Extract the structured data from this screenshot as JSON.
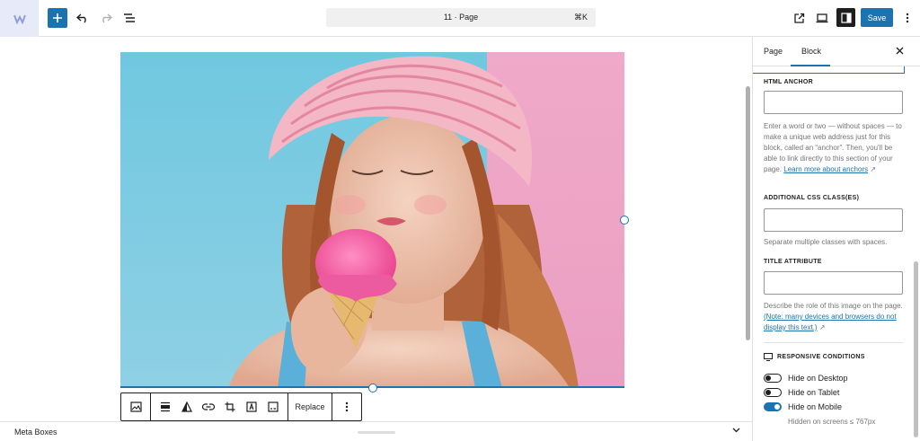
{
  "topbar": {
    "document_title": "11 · Page",
    "shortcut": "⌘K",
    "save_label": "Save",
    "icons": [
      "site-logo-icon",
      "plus-icon",
      "undo-icon",
      "redo-icon",
      "list-view-icon",
      "external-link-icon",
      "desktop-preview-icon",
      "sidebar-icon",
      "more-vertical-icon"
    ]
  },
  "canvas": {
    "image_alt": "Woman in pink knit hat eating pink ice cream cone",
    "toolbar": {
      "replace_label": "Replace",
      "icons": [
        "image-icon",
        "align-icon",
        "duotone-icon",
        "link-icon",
        "crop-icon",
        "text-over-image-icon",
        "caption-icon",
        "more-vertical-icon"
      ]
    }
  },
  "sidebar": {
    "tabs": [
      {
        "label": "Page",
        "active": false
      },
      {
        "label": "Block",
        "active": true
      }
    ],
    "close_icon": "close-icon",
    "html_anchor": {
      "label": "HTML ANCHOR",
      "value": "",
      "help_text": "Enter a word or two — without spaces — to make a unique web address just for this block, called an “anchor”. Then, you'll be able to link directly to this section of your page.",
      "help_link": "Learn more about anchors",
      "link_icon": "↗"
    },
    "css_classes": {
      "label": "ADDITIONAL CSS CLASS(ES)",
      "value": "",
      "help_text": "Separate multiple classes with spaces."
    },
    "title_attribute": {
      "label": "TITLE ATTRIBUTE",
      "value": "",
      "help_text": "Describe the role of this image on the page.",
      "help_link": "(Note: many devices and browsers do not display this text.)",
      "link_icon": "↗"
    },
    "responsive": {
      "label": "RESPONSIVE CONDITIONS",
      "toggles": [
        {
          "label": "Hide on Desktop",
          "on": false
        },
        {
          "label": "Hide on Tablet",
          "on": false
        },
        {
          "label": "Hide on Mobile",
          "on": true
        }
      ],
      "note": "Hidden on screens ≤ 767px"
    }
  },
  "meta_boxes": {
    "label": "Meta Boxes"
  },
  "colors": {
    "accent": "#1b73b0",
    "dark": "#1e1e1e",
    "muted": "#757575"
  }
}
